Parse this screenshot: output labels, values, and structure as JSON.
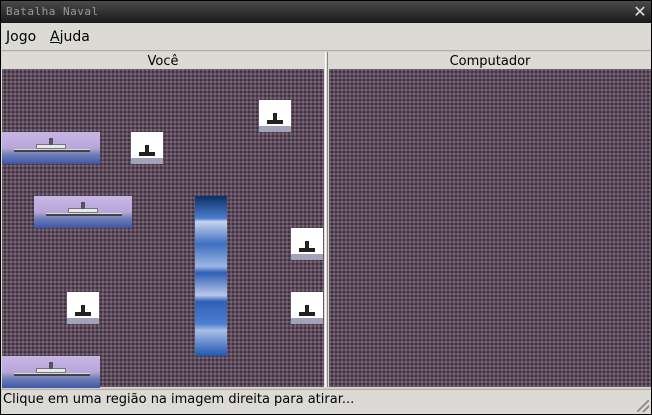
{
  "window": {
    "title": "Batalha Naval",
    "close_symbol": "✕"
  },
  "menu": {
    "items": [
      {
        "label": "Jogo",
        "accel": "J"
      },
      {
        "label": "Ajuda",
        "accel": "A"
      }
    ]
  },
  "boards": {
    "player_label": "Você",
    "computer_label": "Computador"
  },
  "status": {
    "text": "Clique em uma região na imagem direita para atirar..."
  },
  "icons": {
    "close": "close-icon",
    "frigate": "frigate-icon",
    "submarine": "submarine-icon",
    "vertical_ship": "aircraft-carrier-icon"
  },
  "colors": {
    "sea": "#5a4a5a",
    "chrome": "#dcdad5",
    "titlebar": "#1a1a1a"
  }
}
